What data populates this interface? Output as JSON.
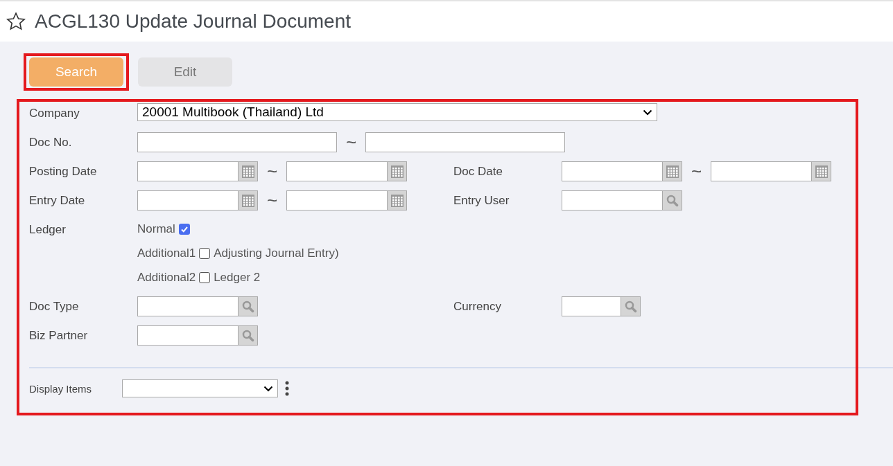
{
  "header": {
    "title": "ACGL130 Update Journal Document",
    "favorite": false
  },
  "toolbar": [
    {
      "label": "Search",
      "kind": "primary",
      "highlighted": true
    },
    {
      "label": "Edit",
      "kind": "secondary",
      "highlighted": false
    }
  ],
  "form": {
    "highlighted": true,
    "rows": [
      {
        "left": {
          "label": "Company",
          "kind": "select",
          "value": "20001 Multibook (Thailand) Ltd"
        }
      },
      {
        "left": {
          "label": "Doc No.",
          "kind": "text_range",
          "separator": "~"
        }
      },
      {
        "left": {
          "label": "Posting Date",
          "kind": "date_range",
          "separator": "~"
        },
        "right": {
          "label": "Doc Date",
          "kind": "date_range",
          "separator": "~"
        }
      },
      {
        "left": {
          "label": "Entry Date",
          "kind": "date_range",
          "separator": "~"
        },
        "right": {
          "label": "Entry User",
          "kind": "lookup",
          "compact": false
        }
      },
      {
        "left": {
          "label": "Ledger",
          "kind": "checks",
          "options": [
            {
              "label": "Normal",
              "checked": true
            },
            {
              "label": "Additional1",
              "checked": false,
              "note": "Adjusting Journal Entry)"
            },
            {
              "label": "Additional2",
              "checked": false,
              "note": "Ledger 2"
            }
          ]
        }
      },
      {
        "left": {
          "label": "Doc Type",
          "kind": "lookup",
          "compact": false
        },
        "right": {
          "label": "Currency",
          "kind": "lookup",
          "compact": true
        }
      },
      {
        "left": {
          "label": "Biz Partner",
          "kind": "lookup",
          "compact": false
        }
      }
    ],
    "display_items": {
      "label": "Display Items"
    }
  }
}
